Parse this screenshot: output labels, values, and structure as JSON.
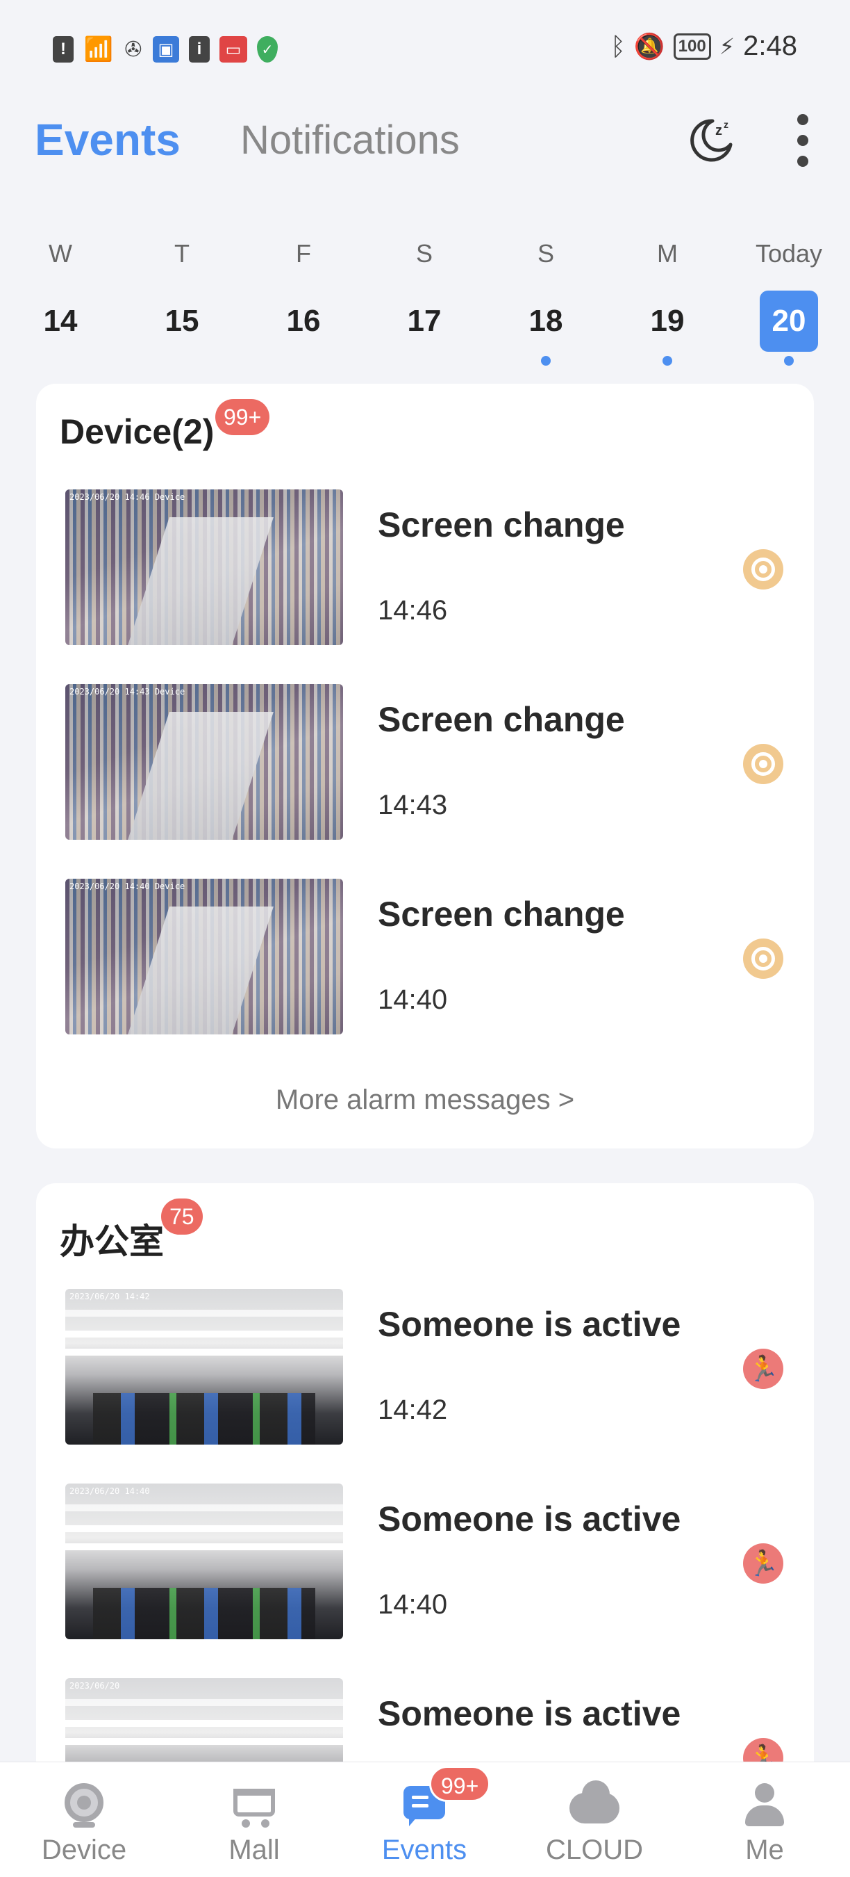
{
  "status_bar": {
    "icons": [
      "alert-icon",
      "wifi-icon",
      "sim-icon",
      "app-icon",
      "info-icon",
      "tv-icon",
      "shield-icon"
    ],
    "right_icons": [
      "bluetooth-icon",
      "mute-icon",
      "battery-icon",
      "charging-icon"
    ],
    "battery": "100",
    "time": "2:48"
  },
  "header": {
    "tab_events": "Events",
    "tab_notifications": "Notifications"
  },
  "calendar": {
    "days": [
      {
        "dow": "W",
        "num": "14",
        "has_events": false
      },
      {
        "dow": "T",
        "num": "15",
        "has_events": false
      },
      {
        "dow": "F",
        "num": "16",
        "has_events": false
      },
      {
        "dow": "S",
        "num": "17",
        "has_events": false
      },
      {
        "dow": "S",
        "num": "18",
        "has_events": true
      },
      {
        "dow": "M",
        "num": "19",
        "has_events": true
      },
      {
        "dow": "Today",
        "num": "20",
        "has_events": true,
        "selected": true
      }
    ]
  },
  "groups": [
    {
      "title": "Device(2)",
      "badge": "99+",
      "events": [
        {
          "title": "Screen change",
          "time": "14:46",
          "type_icon": "screen-change-icon"
        },
        {
          "title": "Screen change",
          "time": "14:43",
          "type_icon": "screen-change-icon"
        },
        {
          "title": "Screen change",
          "time": "14:40",
          "type_icon": "screen-change-icon"
        }
      ],
      "more": "More alarm messages >"
    },
    {
      "title": "办公室",
      "badge": "75",
      "events": [
        {
          "title": "Someone is active",
          "time": "14:42",
          "type_icon": "motion-icon"
        },
        {
          "title": "Someone is active",
          "time": "14:40",
          "type_icon": "motion-icon"
        },
        {
          "title": "Someone is active",
          "time": "",
          "type_icon": "motion-icon"
        }
      ]
    }
  ],
  "bottom_nav": {
    "items": [
      {
        "label": "Device",
        "icon": "camera-icon"
      },
      {
        "label": "Mall",
        "icon": "cart-icon"
      },
      {
        "label": "Events",
        "icon": "message-icon",
        "active": true
      },
      {
        "label": "CLOUD",
        "icon": "cloud-icon"
      },
      {
        "label": "Me",
        "icon": "person-icon"
      }
    ],
    "events_badge": "99+"
  },
  "colors": {
    "accent": "#4d8ff0",
    "badge": "#ec6a62",
    "screen_change": "#f1c98f",
    "motion": "#ec7a78",
    "background": "#f3f4f8"
  }
}
